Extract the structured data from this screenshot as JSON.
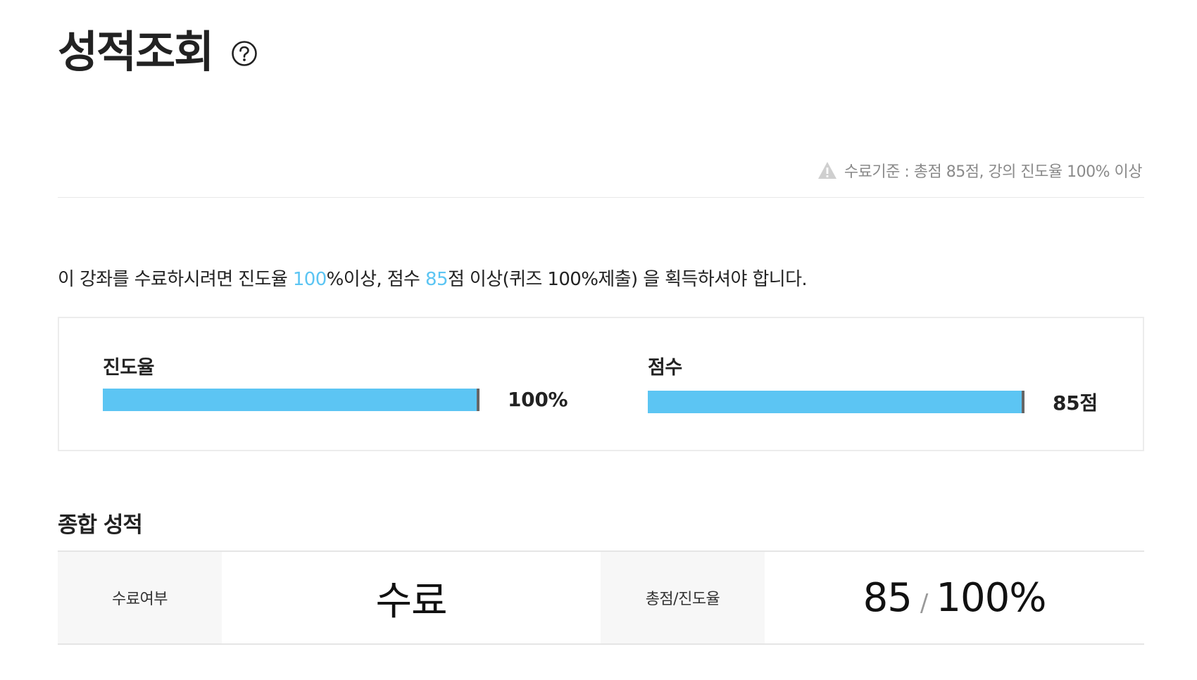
{
  "header": {
    "title": "성적조회",
    "help_icon": "question-circle-icon"
  },
  "criteria": {
    "icon": "warning-triangle-icon",
    "text": "수료기준 : 총점 85점, 강의 진도율 100% 이상"
  },
  "notice": {
    "part1": "이 강좌를 수료하시려면 진도율 ",
    "progress_req": "100",
    "part2": "%이상, 점수 ",
    "score_req": "85",
    "part3": "점 이상(퀴즈 100%제출) 을 획득하셔야 합니다."
  },
  "progress": {
    "label": "진도율",
    "value_text": "100%",
    "fill_fraction": 1.0
  },
  "score": {
    "label": "점수",
    "value_text": "85점",
    "fill_fraction": 1.0
  },
  "summary": {
    "section_title": "종합 성적",
    "completion_label": "수료여부",
    "completion_value": "수료",
    "total_label": "총점/진도율",
    "total_score": "85",
    "separator": "/",
    "total_progress": "100%"
  },
  "colors": {
    "accent": "#5cc5f3",
    "bar_end": "#666666",
    "muted_text": "#8a8a8a"
  }
}
